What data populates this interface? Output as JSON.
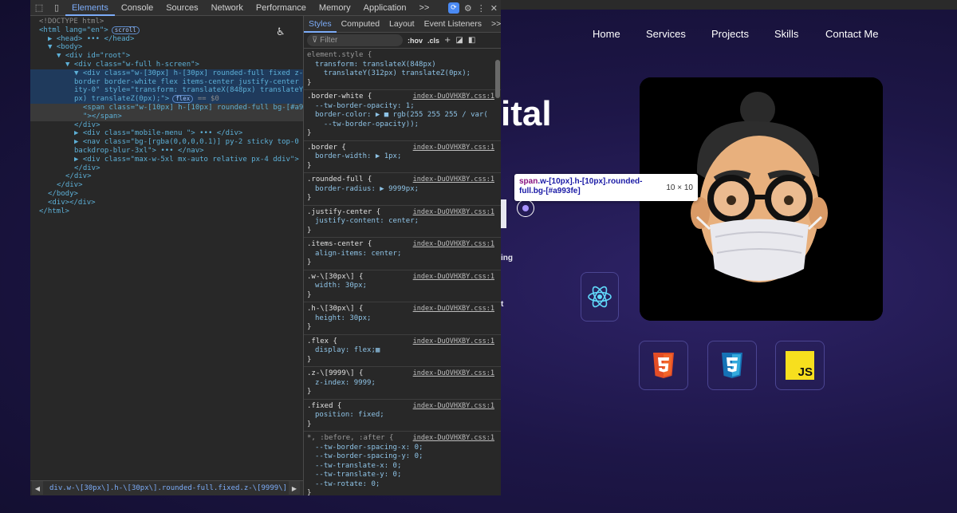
{
  "site": {
    "nav": [
      "Home",
      "Services",
      "Projects",
      "Skills",
      "Contact Me"
    ],
    "hero_fragment": "ital",
    "hero_side_texts": [
      "ing",
      "t"
    ],
    "tooltip": {
      "selector_tag": "span",
      "selector_classes": ".w-[10px].h-[10px].rounded-full.bg-[#a993fe]",
      "size": "10 × 10"
    },
    "skills": [
      {
        "name": "react-icon",
        "color": "#61dafb"
      },
      {
        "name": "html5-icon",
        "color": "#e44d26"
      },
      {
        "name": "css3-icon",
        "color": "#2965f1"
      },
      {
        "name": "javascript-icon",
        "color": "#f7df1e",
        "label": "JS"
      }
    ],
    "accent_color": "#a993fe"
  },
  "devtools": {
    "tabs": [
      "Elements",
      "Console",
      "Sources",
      "Network",
      "Performance",
      "Memory",
      "Application"
    ],
    "more": ">>",
    "elements": [
      {
        "t": "<!DOCTYPE html>"
      },
      {
        "t": "<html lang=\"en\">",
        "pill": "scroll"
      },
      {
        "t": "▶ <head> ••• </head>"
      },
      {
        "t": "▼ <body>"
      },
      {
        "t": "▼ <div id=\"root\">"
      },
      {
        "t": "▼ <div class=\"w-full h-screen\">"
      },
      {
        "t": "▼ <div class=\"w-[30px] h-[30px] rounded-full fixed z-[9999]"
      },
      {
        "t": "border border-white flex items-center justify-center opac"
      },
      {
        "t": "ity-0\" style=\"transform: translateX(848px) translateY(312"
      },
      {
        "t": "px) translateZ(0px);\">",
        "pill": "flex",
        "suffix": " == $0"
      },
      {
        "t": "<span class=\"w-[10px] h-[10px] rounded-full bg-[#a993fe]"
      },
      {
        "t": "\"></span>"
      },
      {
        "t": "</div>"
      },
      {
        "t": "▶ <div class=\"mobile-menu \"> ••• </div>"
      },
      {
        "t": "▶ <nav class=\"bg-[rgba(0,0,0,0.1)] py-2 sticky top-0 z-[30]"
      },
      {
        "t": "backdrop-blur-3xl\"> ••• </nav>"
      },
      {
        "t": "▶ <div class=\"max-w-5xl mx-auto relative px-4 ddiv\"> •••"
      },
      {
        "t": "</div>"
      },
      {
        "t": "</div>"
      },
      {
        "t": "</div>"
      },
      {
        "t": "</body>"
      },
      {
        "t": "<div></div>"
      },
      {
        "t": "</html>"
      }
    ],
    "breadcrumb": "div.w-\\[30px\\].h-\\[30px\\].rounded-full.fixed.z-\\[9999\\].border.border",
    "styles_tabs": [
      "Styles",
      "Computed",
      "Layout",
      "Event Listeners",
      ">>"
    ],
    "filter_placeholder": "Filter",
    "filter_buttons": [
      ":hov",
      ".cls",
      "+"
    ],
    "rules": [
      {
        "selector": "element.style {",
        "source": "",
        "decls": [
          "transform: translateX(848px)",
          "  translateY(312px) translateZ(0px);"
        ]
      },
      {
        "selector": ".border-white {",
        "source": "index-DuOVHXBY.css:1",
        "decls": [
          "--tw-border-opacity: 1;",
          "border-color: ▶ ■ rgb(255 255 255 / var(",
          "  --tw-border-opacity));"
        ]
      },
      {
        "selector": ".border {",
        "source": "index-DuOVHXBY.css:1",
        "decls": [
          "border-width: ▶ 1px;"
        ]
      },
      {
        "selector": ".rounded-full {",
        "source": "index-DuOVHXBY.css:1",
        "decls": [
          "border-radius: ▶ 9999px;"
        ]
      },
      {
        "selector": ".justify-center {",
        "source": "index-DuOVHXBY.css:1",
        "decls": [
          "justify-content: center;"
        ]
      },
      {
        "selector": ".items-center {",
        "source": "index-DuOVHXBY.css:1",
        "decls": [
          "align-items: center;"
        ]
      },
      {
        "selector": ".w-\\[30px\\] {",
        "source": "index-DuOVHXBY.css:1",
        "decls": [
          "width: 30px;"
        ]
      },
      {
        "selector": ".h-\\[30px\\] {",
        "source": "index-DuOVHXBY.css:1",
        "decls": [
          "height: 30px;"
        ]
      },
      {
        "selector": ".flex {",
        "source": "index-DuOVHXBY.css:1",
        "decls": [
          "display: flex;▦"
        ]
      },
      {
        "selector": ".z-\\[9999\\] {",
        "source": "index-DuOVHXBY.css:1",
        "decls": [
          "z-index: 9999;"
        ]
      },
      {
        "selector": ".fixed {",
        "source": "index-DuOVHXBY.css:1",
        "decls": [
          "position: fixed;"
        ]
      },
      {
        "selector": "*, :before, :after {",
        "source": "index-DuOVHXBY.css:1",
        "decls": [
          "--tw-border-spacing-x: 0;",
          "--tw-border-spacing-y: 0;",
          "--tw-translate-x: 0;",
          "--tw-translate-y: 0;",
          "--tw-rotate: 0;"
        ]
      }
    ]
  }
}
